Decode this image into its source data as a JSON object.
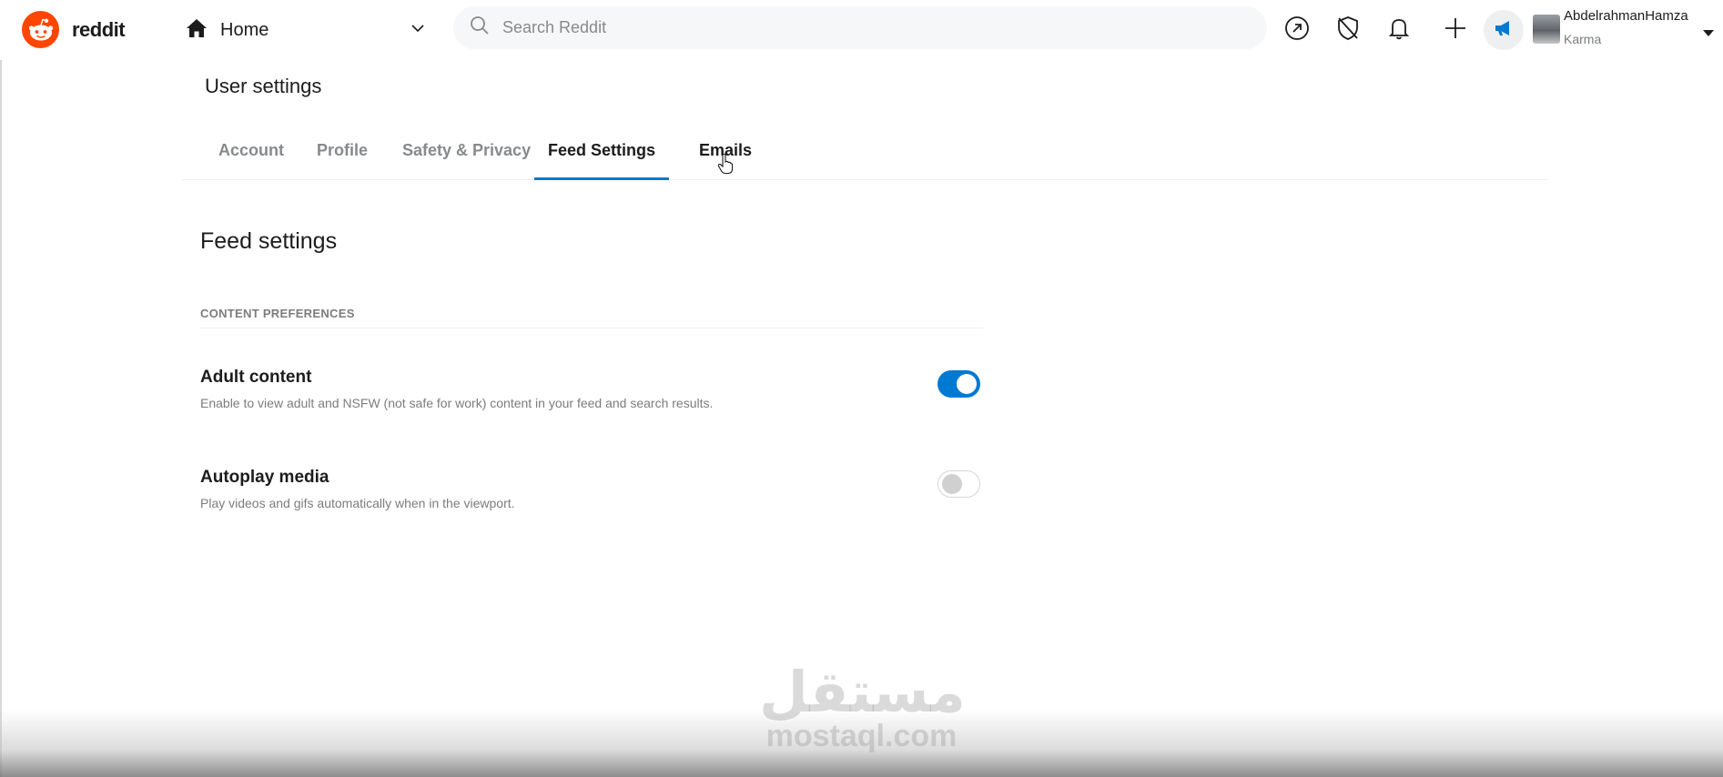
{
  "brand": {
    "name": "reddit",
    "color": "#ff4500"
  },
  "nav": {
    "home_label": "Home"
  },
  "search": {
    "placeholder": "Search Reddit"
  },
  "header_icons": [
    "popular-icon",
    "mod-shield-icon",
    "bell-icon",
    "plus-icon",
    "advertise-icon"
  ],
  "user": {
    "name": "AbdelrahmanHamza",
    "karma_label": "Karma"
  },
  "settings": {
    "title": "User settings",
    "tabs": [
      {
        "label": "Account",
        "active": false
      },
      {
        "label": "Profile",
        "active": false
      },
      {
        "label": "Safety & Privacy",
        "active": false
      },
      {
        "label": "Feed Settings",
        "active": true
      },
      {
        "label": "Emails",
        "active": false
      }
    ]
  },
  "feed": {
    "heading": "Feed settings",
    "section": "CONTENT PREFERENCES",
    "rows": [
      {
        "title": "Adult content",
        "description": "Enable to view adult and NSFW (not safe for work) content in your feed and search results.",
        "enabled": true
      },
      {
        "title": "Autoplay media",
        "description": "Play videos and gifs automatically when in the viewport.",
        "enabled": false
      }
    ]
  },
  "watermark": {
    "arabic": "مستقل",
    "latin": "mostaql.com"
  },
  "colors": {
    "accent": "#0079d3",
    "muted_text": "#7c7c7c"
  }
}
